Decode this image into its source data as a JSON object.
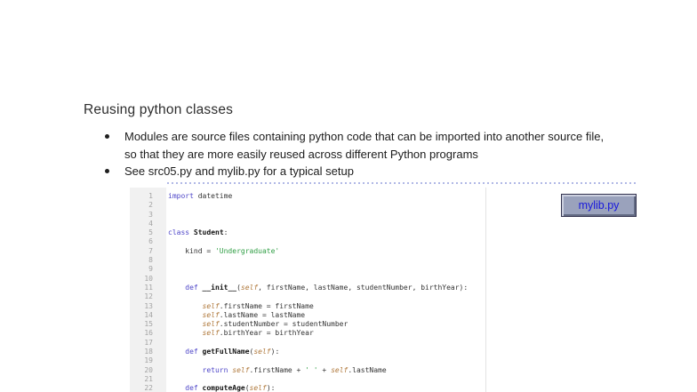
{
  "slide": {
    "title": "Reusing python classes",
    "bullets": [
      "Modules are source files containing python code that can be imported into another source file, so that they are more easily reused across different Python programs",
      "See src05.py and mylib.py for a typical setup"
    ]
  },
  "code_panel": {
    "lines": [
      {
        "n": 1,
        "tokens": [
          [
            "kw",
            "import"
          ],
          [
            "pl",
            " datetime"
          ]
        ]
      },
      {
        "n": 2,
        "tokens": []
      },
      {
        "n": 3,
        "tokens": []
      },
      {
        "n": 4,
        "tokens": []
      },
      {
        "n": 5,
        "tokens": [
          [
            "kw",
            "class"
          ],
          [
            "pl",
            " "
          ],
          [
            "fn",
            "Student"
          ],
          [
            "pl",
            ":"
          ]
        ]
      },
      {
        "n": 6,
        "tokens": []
      },
      {
        "n": 7,
        "tokens": [
          [
            "pl",
            "    kind = "
          ],
          [
            "str",
            "'Undergraduate'"
          ]
        ]
      },
      {
        "n": 8,
        "tokens": []
      },
      {
        "n": 9,
        "tokens": []
      },
      {
        "n": 10,
        "tokens": []
      },
      {
        "n": 11,
        "tokens": [
          [
            "pl",
            "    "
          ],
          [
            "kw",
            "def"
          ],
          [
            "pl",
            " "
          ],
          [
            "fn",
            "__init__"
          ],
          [
            "pl",
            "("
          ],
          [
            "self",
            "self"
          ],
          [
            "pl",
            ", firstName, lastName, studentNumber, birthYear):"
          ]
        ]
      },
      {
        "n": 12,
        "tokens": []
      },
      {
        "n": 13,
        "tokens": [
          [
            "pl",
            "        "
          ],
          [
            "self",
            "self"
          ],
          [
            "pl",
            ".firstName = firstName"
          ]
        ]
      },
      {
        "n": 14,
        "tokens": [
          [
            "pl",
            "        "
          ],
          [
            "self",
            "self"
          ],
          [
            "pl",
            ".lastName = lastName"
          ]
        ]
      },
      {
        "n": 15,
        "tokens": [
          [
            "pl",
            "        "
          ],
          [
            "self",
            "self"
          ],
          [
            "pl",
            ".studentNumber = studentNumber"
          ]
        ]
      },
      {
        "n": 16,
        "tokens": [
          [
            "pl",
            "        "
          ],
          [
            "self",
            "self"
          ],
          [
            "pl",
            ".birthYear = birthYear"
          ]
        ]
      },
      {
        "n": 17,
        "tokens": []
      },
      {
        "n": 18,
        "tokens": [
          [
            "pl",
            "    "
          ],
          [
            "kw",
            "def"
          ],
          [
            "pl",
            " "
          ],
          [
            "fn",
            "getFullName"
          ],
          [
            "pl",
            "("
          ],
          [
            "self",
            "self"
          ],
          [
            "pl",
            "):"
          ]
        ]
      },
      {
        "n": 19,
        "tokens": []
      },
      {
        "n": 20,
        "tokens": [
          [
            "pl",
            "        "
          ],
          [
            "kw",
            "return"
          ],
          [
            "pl",
            " "
          ],
          [
            "self",
            "self"
          ],
          [
            "pl",
            ".firstName + "
          ],
          [
            "str",
            "' '"
          ],
          [
            "pl",
            " + "
          ],
          [
            "self",
            "self"
          ],
          [
            "pl",
            ".lastName"
          ]
        ]
      },
      {
        "n": 21,
        "tokens": []
      },
      {
        "n": 22,
        "tokens": [
          [
            "pl",
            "    "
          ],
          [
            "kw",
            "def"
          ],
          [
            "pl",
            " "
          ],
          [
            "fn",
            "computeAge"
          ],
          [
            "pl",
            "("
          ],
          [
            "self",
            "self"
          ],
          [
            "pl",
            "):"
          ]
        ]
      }
    ]
  },
  "label_box": {
    "text": "mylib.py",
    "text_color": "#1717dc",
    "fill_color": "#9aa2bc"
  },
  "colors": {
    "page_background": "#ffffff",
    "title_text": "#2d2d2d",
    "body_text": "#1c1c1c",
    "dashed_divider": "#b0b8e6",
    "gutter_background": "#f1f1f1",
    "line_number_text": "#a3a3a3",
    "code_keyword": "#4e46c8",
    "code_self": "#b0793c",
    "code_string": "#2f9e44",
    "code_plain": "#333333"
  }
}
